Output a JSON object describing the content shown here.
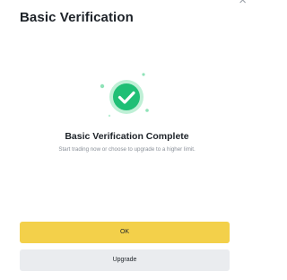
{
  "dialog": {
    "title": "Basic Verification",
    "close_label": "×",
    "headline": "Basic Verification Complete",
    "subline": "Start trading now or choose to upgrade to a higher limit.",
    "ok_label": "OK",
    "upgrade_label": "Upgrade"
  },
  "colors": {
    "accent_green": "#1fbf75",
    "primary_yellow": "#f3d04a",
    "secondary_gray": "#eaecef"
  },
  "icons": {
    "success": "check-circle-icon",
    "close": "close-icon"
  }
}
